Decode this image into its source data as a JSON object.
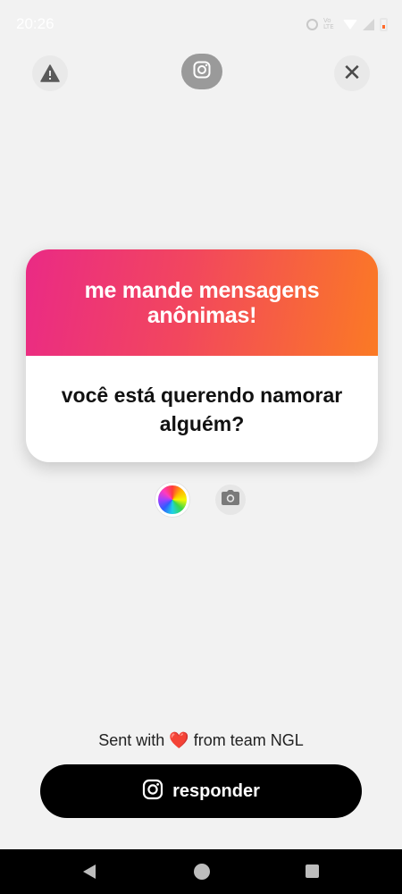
{
  "status_bar": {
    "time": "20:26",
    "data_label": "Vo LTE",
    "icons": [
      "alarm-icon",
      "lte-icon",
      "wifi-icon",
      "signal-icon",
      "battery-icon"
    ]
  },
  "top_actions": {
    "report_icon": "warning-icon",
    "instagram_icon": "instagram-icon",
    "close_icon": "close-icon",
    "close_glyph": "✕"
  },
  "card": {
    "title": "me mande mensagens anônimas!",
    "question": "você está querendo namorar alguém?",
    "gradient_start": "#ea2a85",
    "gradient_end": "#fb7a24"
  },
  "tools": {
    "color_picker_icon": "color-wheel-icon",
    "camera_icon": "camera-icon"
  },
  "footer": {
    "sent_prefix": "Sent with",
    "heart": "❤️",
    "sent_suffix": "from team NGL",
    "respond_label": "responder"
  },
  "nav_bar": {
    "buttons": [
      "back",
      "home",
      "recents"
    ]
  }
}
